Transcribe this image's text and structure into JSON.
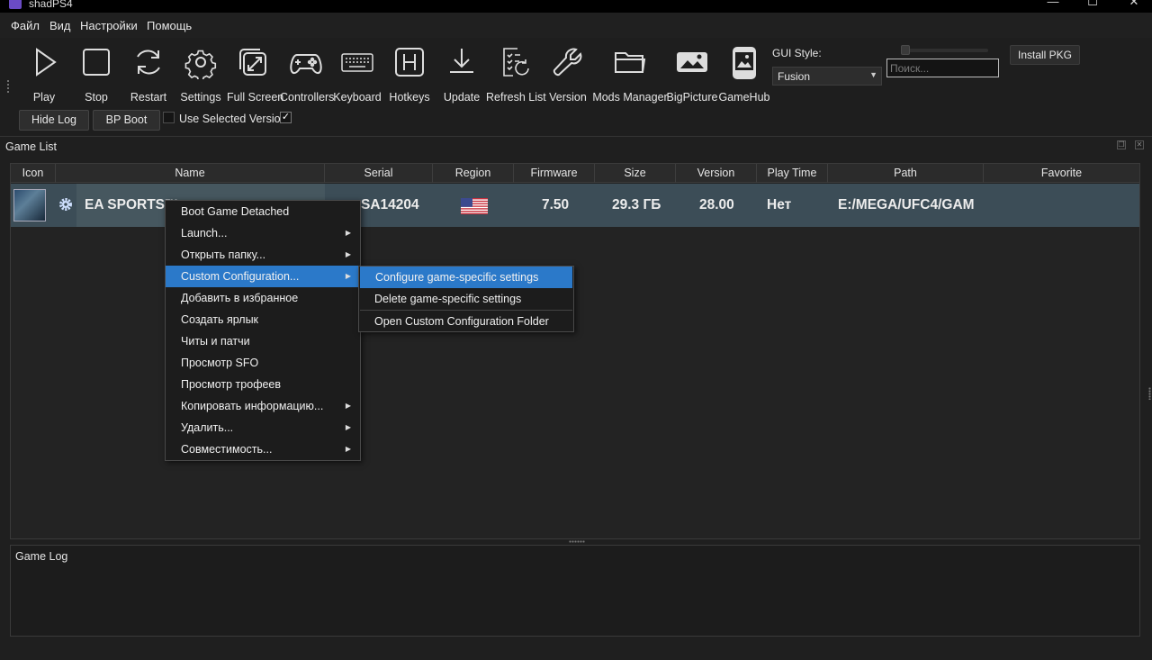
{
  "window": {
    "title": "shadPS4",
    "min": "—",
    "max": "☐",
    "close": "✕"
  },
  "menubar": [
    "Файл",
    "Вид",
    "Настройки",
    "Помощь"
  ],
  "toolbar": {
    "tools": [
      "Play",
      "Stop",
      "Restart",
      "Settings",
      "Full Screen",
      "Controllers",
      "Keyboard",
      "Hotkeys",
      "Update",
      "Refresh List",
      "Version",
      "Mods Manager",
      "BigPicture",
      "GameHub"
    ],
    "gui_style_label": "GUI Style:",
    "gui_style_value": "Fusion",
    "search_placeholder": "Поиск...",
    "install_pkg": "Install PKG",
    "hide_log": "Hide Log",
    "bp_boot": "BP Boot",
    "use_selected_version": "Use Selected Version",
    "use_selected_version_checked": true,
    "check_mark": "✓"
  },
  "game_list": {
    "title": "Game List",
    "columns": [
      "Icon",
      "Name",
      "Serial",
      "Region",
      "Firmware",
      "Size",
      "Version",
      "Play Time",
      "Path",
      "Favorite"
    ],
    "row": {
      "name": "EA SPORTS™",
      "serial": "SA14204",
      "firmware": "7.50",
      "size": "29.3 ГБ",
      "version": "28.00",
      "play_time": "Нет",
      "path": "E:/MEGA/UFC4/GAM"
    }
  },
  "context_menu": {
    "items": [
      {
        "label": "Boot Game Detached",
        "submenu": false
      },
      {
        "label": "Launch...",
        "submenu": true
      },
      {
        "label": "Открыть папку...",
        "submenu": true
      },
      {
        "label": "Custom Configuration...",
        "submenu": true,
        "highlighted": true
      },
      {
        "label": "Добавить в избранное",
        "submenu": false
      },
      {
        "label": "Создать ярлык",
        "submenu": false
      },
      {
        "label": "Читы и патчи",
        "submenu": false
      },
      {
        "label": "Просмотр SFO",
        "submenu": false
      },
      {
        "label": "Просмотр трофеев",
        "submenu": false
      },
      {
        "label": "Копировать информацию...",
        "submenu": true
      },
      {
        "label": "Удалить...",
        "submenu": true
      },
      {
        "label": "Совместимость...",
        "submenu": true
      }
    ],
    "submenu": [
      "Configure game-specific settings",
      "Delete game-specific settings",
      "Open Custom Configuration Folder"
    ]
  },
  "game_log": {
    "title": "Game Log"
  },
  "colors": {
    "highlight": "#2b79c9",
    "row_bg": "#3c4d57",
    "background": "#1f1f1f"
  }
}
